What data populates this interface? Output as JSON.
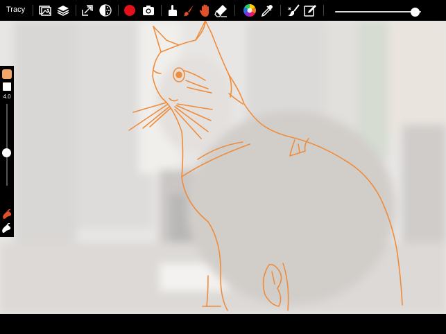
{
  "header": {
    "title": "Tracy"
  },
  "toolbar": {
    "tools": [
      {
        "icon": "image-icon"
      },
      {
        "icon": "layers-icon"
      },
      {
        "icon": "transform-icon"
      },
      {
        "icon": "opacity-icon"
      },
      {
        "icon": "record-icon",
        "color": "#e4101a"
      },
      {
        "icon": "camera-icon"
      },
      {
        "icon": "smudge-icon"
      },
      {
        "icon": "brush-icon",
        "color": "#e0502a"
      },
      {
        "icon": "hand-icon",
        "color": "#e0502a"
      },
      {
        "icon": "eraser-icon"
      },
      {
        "icon": "color-wheel-icon"
      },
      {
        "icon": "eyedropper-icon"
      },
      {
        "icon": "clear-icon"
      },
      {
        "icon": "edit-icon"
      }
    ],
    "slider_level": 0.93
  },
  "side_panel": {
    "primary_color": "#f3a66a",
    "secondary_color": "#ffffff",
    "brush_size": "4.0",
    "brush_size_level": 0.4
  },
  "canvas": {
    "stroke_color": "#ee8c3c"
  }
}
